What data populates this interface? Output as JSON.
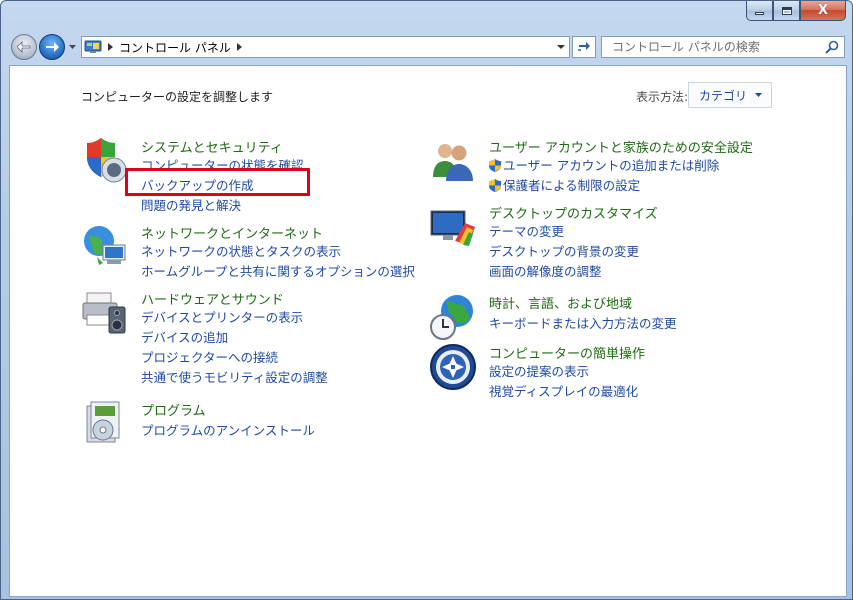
{
  "window": {
    "caption": {
      "minimize": "–",
      "maximize": "□",
      "close": "X"
    }
  },
  "nav": {
    "back_icon": "arrow-left-icon",
    "forward_icon": "arrow-right-icon",
    "crumbs": [
      "コントロール パネル"
    ],
    "search_placeholder": "コントロール パネルの検索"
  },
  "main": {
    "heading": "コンピューターの設定を調整します",
    "view_by_label": "表示方法:",
    "view_by_value": "カテゴリ"
  },
  "categories_left": [
    {
      "icon": "shield-computer-icon",
      "title": "システムとセキュリティ",
      "links": [
        "コンピューターの状態を確認",
        "バックアップの作成",
        "問題の発見と解決"
      ]
    },
    {
      "icon": "network-globe-icon",
      "title": "ネットワークとインターネット",
      "links": [
        "ネットワークの状態とタスクの表示",
        "ホームグループと共有に関するオプションの選択"
      ]
    },
    {
      "icon": "printer-speaker-icon",
      "title": "ハードウェアとサウンド",
      "links": [
        "デバイスとプリンターの表示",
        "デバイスの追加",
        "プロジェクターへの接続",
        "共通で使うモビリティ設定の調整"
      ]
    },
    {
      "icon": "programs-disc-icon",
      "title": "プログラム",
      "links": [
        "プログラムのアンインストール"
      ]
    }
  ],
  "categories_right": [
    {
      "icon": "users-icon",
      "title": "ユーザー アカウントと家族のための安全設定",
      "links": [
        "ユーザー アカウントの追加または削除",
        "保護者による制限の設定"
      ]
    },
    {
      "icon": "display-palette-icon",
      "title": "デスクトップのカスタマイズ",
      "links": [
        "テーマの変更",
        "デスクトップの背景の変更",
        "画面の解像度の調整"
      ]
    },
    {
      "icon": "globe-clock-icon",
      "title": "時計、言語、および地域",
      "links": [
        "キーボードまたは入力方法の変更"
      ]
    },
    {
      "icon": "ease-of-access-icon",
      "title": "コンピューターの簡単操作",
      "links": [
        "設定の提案の表示",
        "視覚ディスプレイの最適化"
      ]
    }
  ],
  "colors": {
    "category_title": "#1d6a12",
    "link": "#1e4aa3",
    "highlight_box": "#e0001b"
  }
}
